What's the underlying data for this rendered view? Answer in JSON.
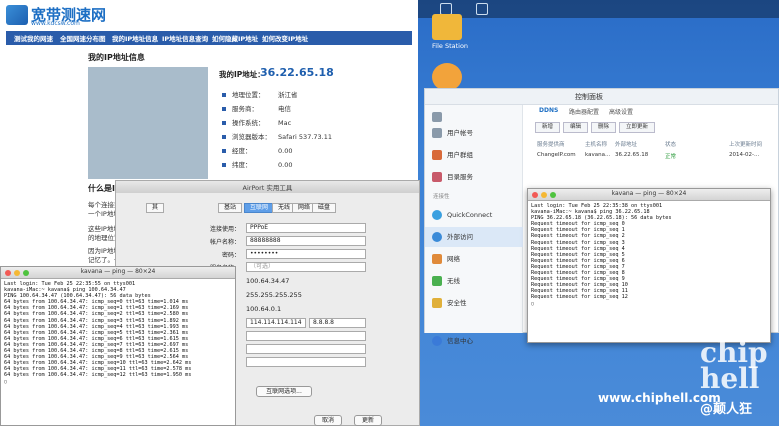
{
  "web": {
    "logo_title": "宽带测速网",
    "logo_url": "www.kdcsw.com",
    "nav": [
      "测试我的网速",
      "全国网速分布图",
      "我的IP地址信息",
      "IP地址信息查询",
      "如何隐藏IP地址",
      "如何改变IP地址"
    ],
    "section_title": "我的IP地址信息",
    "myip_label": "我的IP地址：",
    "myip_value": "36.22.65.18",
    "info": [
      {
        "k": "地理位置：",
        "v": "浙江省"
      },
      {
        "k": "服务商：",
        "v": "电信"
      },
      {
        "k": "操作系统：",
        "v": "Mac"
      },
      {
        "k": "浏览器版本：",
        "v": "Safari 537.73.11"
      },
      {
        "k": "经度：",
        "v": "0.00"
      },
      {
        "k": "纬度：",
        "v": "0.00"
      }
    ],
    "what_title": "什么是IP地",
    "paras": [
      "每个连接到",
      "一个IP地址",
      "这些IP地址",
      "的地理位置",
      "因为IP地址",
      "记忆了。一"
    ]
  },
  "desktop": {
    "file_station_label": "File Station"
  },
  "control_panel": {
    "title": "控制面板",
    "sidebar": [
      {
        "label": "用户帐号",
        "color": "#8a9aaa"
      },
      {
        "label": "用户群组",
        "color": "#d86a3a"
      },
      {
        "label": "目录服务",
        "color": "#c85a6a"
      },
      {
        "label": "连接性",
        "color": "#888"
      },
      {
        "label": "QuickConnect",
        "color": "#3aa0e0"
      },
      {
        "label": "外部访问",
        "color": "#3a8ad8"
      },
      {
        "label": "网络",
        "color": "#e08a3a"
      },
      {
        "label": "无线",
        "color": "#4ab050"
      },
      {
        "label": "安全性",
        "color": "#e0b03a"
      },
      {
        "label": "信息中心",
        "color": "#3a7ad8"
      }
    ],
    "tabs": [
      "DDNS",
      "路由器配置",
      "高级设置"
    ],
    "buttons": [
      "新增",
      "编辑",
      "删除",
      "立即更新"
    ],
    "columns": [
      "服务提供商",
      "主机名称",
      "外部地址",
      "状态",
      "上次更新时间"
    ],
    "row": [
      "ChangeIP.com",
      "kavana...",
      "36.22.65.18",
      "正常",
      "2014-02-..."
    ]
  },
  "terminal_right": {
    "title": "kavana — ping — 80×24",
    "lines": [
      "Last login: Tue Feb 25 22:35:38 on ttys001",
      "kavana-iMac:~ kavana$ ping 36.22.65.18",
      "PING 36.22.65.18 (36.22.65.18): 56 data bytes",
      "Request timeout for icmp_seq 0",
      "Request timeout for icmp_seq 1",
      "Request timeout for icmp_seq 2",
      "Request timeout for icmp_seq 3",
      "Request timeout for icmp_seq 4",
      "Request timeout for icmp_seq 5",
      "Request timeout for icmp_seq 6",
      "Request timeout for icmp_seq 7",
      "Request timeout for icmp_seq 8",
      "Request timeout for icmp_seq 9",
      "Request timeout for icmp_seq 10",
      "Request timeout for icmp_seq 11",
      "Request timeout for icmp_seq 12",
      "▯"
    ]
  },
  "airport": {
    "title": "AirPort 实用工具",
    "tabs": [
      "基站",
      "互联网",
      "无线",
      "网络",
      "磁盘"
    ],
    "selected_tab": "互联网",
    "fields": [
      {
        "label": "连接使用：",
        "value": "PPPoE",
        "kind": "select"
      },
      {
        "label": "帐户名称：",
        "value": "88888888",
        "kind": "input"
      },
      {
        "label": "密码：",
        "value": "••••••••",
        "kind": "input"
      },
      {
        "label": "服务名称：",
        "value": "（可选）",
        "kind": "input"
      }
    ],
    "values": [
      "100.64.34.47",
      "255.255.255.255",
      "100.64.0.1"
    ],
    "dns1": "114.114.114.114",
    "dns2": "8.8.8.8",
    "options_button": "互联网选项...",
    "cancel": "取消",
    "update": "更新",
    "partial_tab": "其"
  },
  "terminal_left": {
    "title": "kavana — ping — 80×24",
    "lines": [
      "Last login: Tue Feb 25 22:35:55 on ttys001",
      "kavana-iMac:~ kavana$ ping 100.64.34.47",
      "PING 100.64.34.47 (100.64.34.47): 56 data bytes",
      "64 bytes from 100.64.34.47: icmp_seq=0 ttl=63 time=1.014 ms",
      "64 bytes from 100.64.34.47: icmp_seq=1 ttl=63 time=2.169 ms",
      "64 bytes from 100.64.34.47: icmp_seq=2 ttl=63 time=2.580 ms",
      "64 bytes from 100.64.34.47: icmp_seq=3 ttl=63 time=1.892 ms",
      "64 bytes from 100.64.34.47: icmp_seq=4 ttl=63 time=1.993 ms",
      "64 bytes from 100.64.34.47: icmp_seq=5 ttl=63 time=2.361 ms",
      "64 bytes from 100.64.34.47: icmp_seq=6 ttl=63 time=1.615 ms",
      "64 bytes from 100.64.34.47: icmp_seq=7 ttl=63 time=2.697 ms",
      "64 bytes from 100.64.34.47: icmp_seq=8 ttl=63 time=2.615 ms",
      "64 bytes from 100.64.34.47: icmp_seq=9 ttl=63 time=2.564 ms",
      "64 bytes from 100.64.34.47: icmp_seq=10 ttl=63 time=2.642 ms",
      "64 bytes from 100.64.34.47: icmp_seq=11 ttl=63 time=2.578 ms",
      "64 bytes from 100.64.34.47: icmp_seq=12 ttl=63 time=1.950 ms",
      "▯"
    ]
  },
  "watermark": {
    "site": "www.chiphell.com",
    "brand": "chip hell",
    "author": "@颠人狂"
  }
}
